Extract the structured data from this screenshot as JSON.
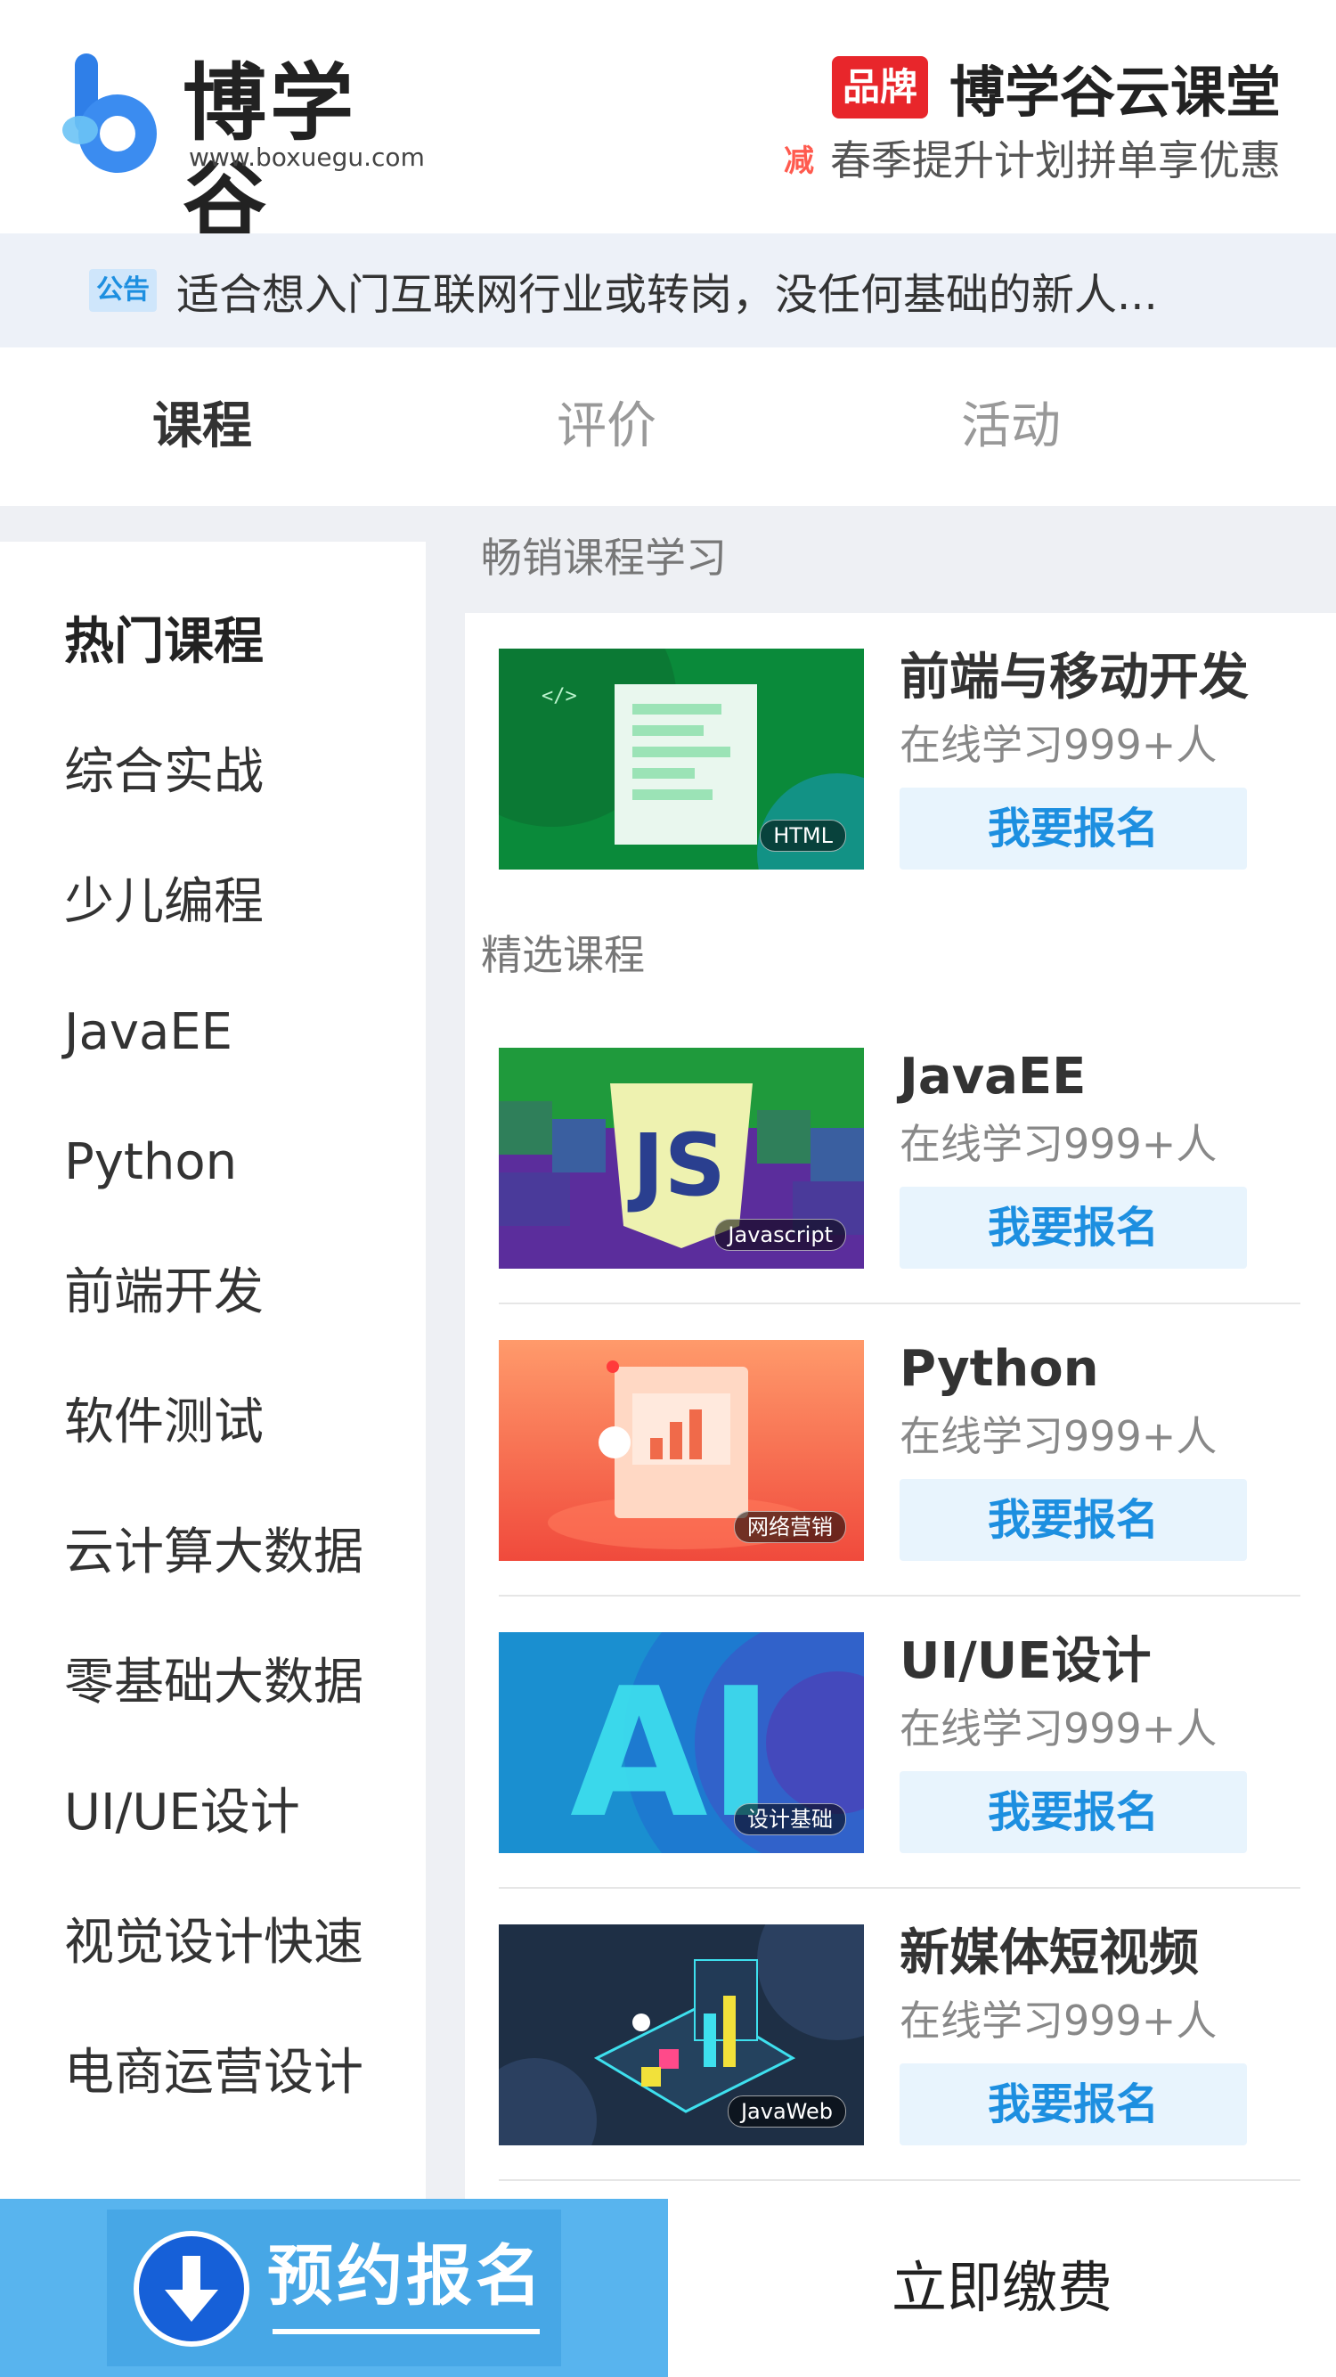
{
  "header": {
    "logo_name": "博学谷",
    "logo_url": "www.boxuegu.com",
    "brand_badge": "品牌",
    "brand_title": "博学谷云课堂",
    "promo_badge": "减",
    "promo_text": "春季提升计划拼单享优惠"
  },
  "notice": {
    "badge": "公告",
    "text": "适合想入门互联网行业或转岗，没任何基础的新人..."
  },
  "tabs": [
    {
      "label": "课程",
      "active": true
    },
    {
      "label": "评价",
      "active": false
    },
    {
      "label": "活动",
      "active": false
    }
  ],
  "sidebar": {
    "items": [
      "热门课程",
      "综合实战",
      "少儿编程",
      "JavaEE",
      "Python",
      "前端开发",
      "软件测试",
      "云计算大数据",
      "零基础大数据",
      "UI/UE设计",
      "视觉设计快速",
      "电商运营设计"
    ],
    "active_index": 0
  },
  "sections": {
    "bestseller_label": "畅销课程学习",
    "selected_label": "精选课程"
  },
  "courses": [
    {
      "title": "前端与移动开发",
      "subtitle": "在线学习999+人",
      "button": "我要报名",
      "tag": "HTML",
      "thumb": "green-html"
    },
    {
      "title": "JavaEE",
      "subtitle": "在线学习999+人",
      "button": "我要报名",
      "tag": "Javascript",
      "thumb": "js-shield"
    },
    {
      "title": "Python",
      "subtitle": "在线学习999+人",
      "button": "我要报名",
      "tag": "网络营销",
      "thumb": "orange-chart"
    },
    {
      "title": "UI/UE设计",
      "subtitle": "在线学习999+人",
      "button": "我要报名",
      "tag": "设计基础",
      "thumb": "blue-ai"
    },
    {
      "title": "新媒体短视频",
      "subtitle": "在线学习999+人",
      "button": "我要报名",
      "tag": "JavaWeb",
      "thumb": "dark-iso"
    }
  ],
  "footer": {
    "reserve_label": "预约报名",
    "pay_label": "立即缴费"
  },
  "colors": {
    "accent_blue": "#1d8fe0",
    "brand_red": "#e8262b",
    "footer_blue": "#58b4ee"
  }
}
